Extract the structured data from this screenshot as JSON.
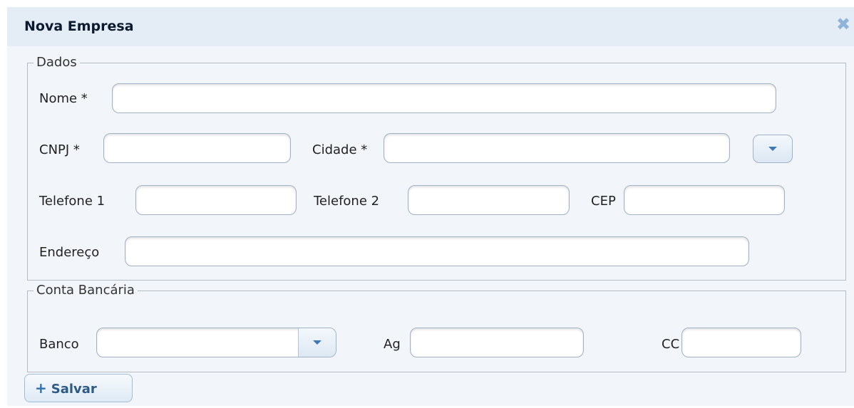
{
  "dialog": {
    "title": "Nova Empresa",
    "close_glyph": "✖"
  },
  "dados": {
    "legend": "Dados",
    "nome_label": "Nome *",
    "nome_value": "",
    "cnpj_label": "CNPJ *",
    "cnpj_value": "",
    "cidade_label": "Cidade *",
    "cidade_value": "",
    "telefone1_label": "Telefone 1",
    "telefone1_value": "",
    "telefone2_label": "Telefone 2",
    "telefone2_value": "",
    "cep_label": "CEP",
    "cep_value": "",
    "endereco_label": "Endereço",
    "endereco_value": ""
  },
  "conta": {
    "legend": "Conta Bancária",
    "banco_label": "Banco",
    "banco_value": "",
    "ag_label": "Ag",
    "ag_value": "",
    "cc_label": "CC",
    "cc_value": ""
  },
  "actions": {
    "salvar_label": "Salvar",
    "salvar_icon": "+"
  },
  "icons": {
    "close": "close-icon",
    "dropdown": "chevron-down-icon",
    "add": "plus-icon"
  },
  "colors": {
    "titlebar": "#e4ecf5",
    "body": "#f2f5f9",
    "accent": "#3b78b5",
    "close": "#8fb4d9"
  }
}
